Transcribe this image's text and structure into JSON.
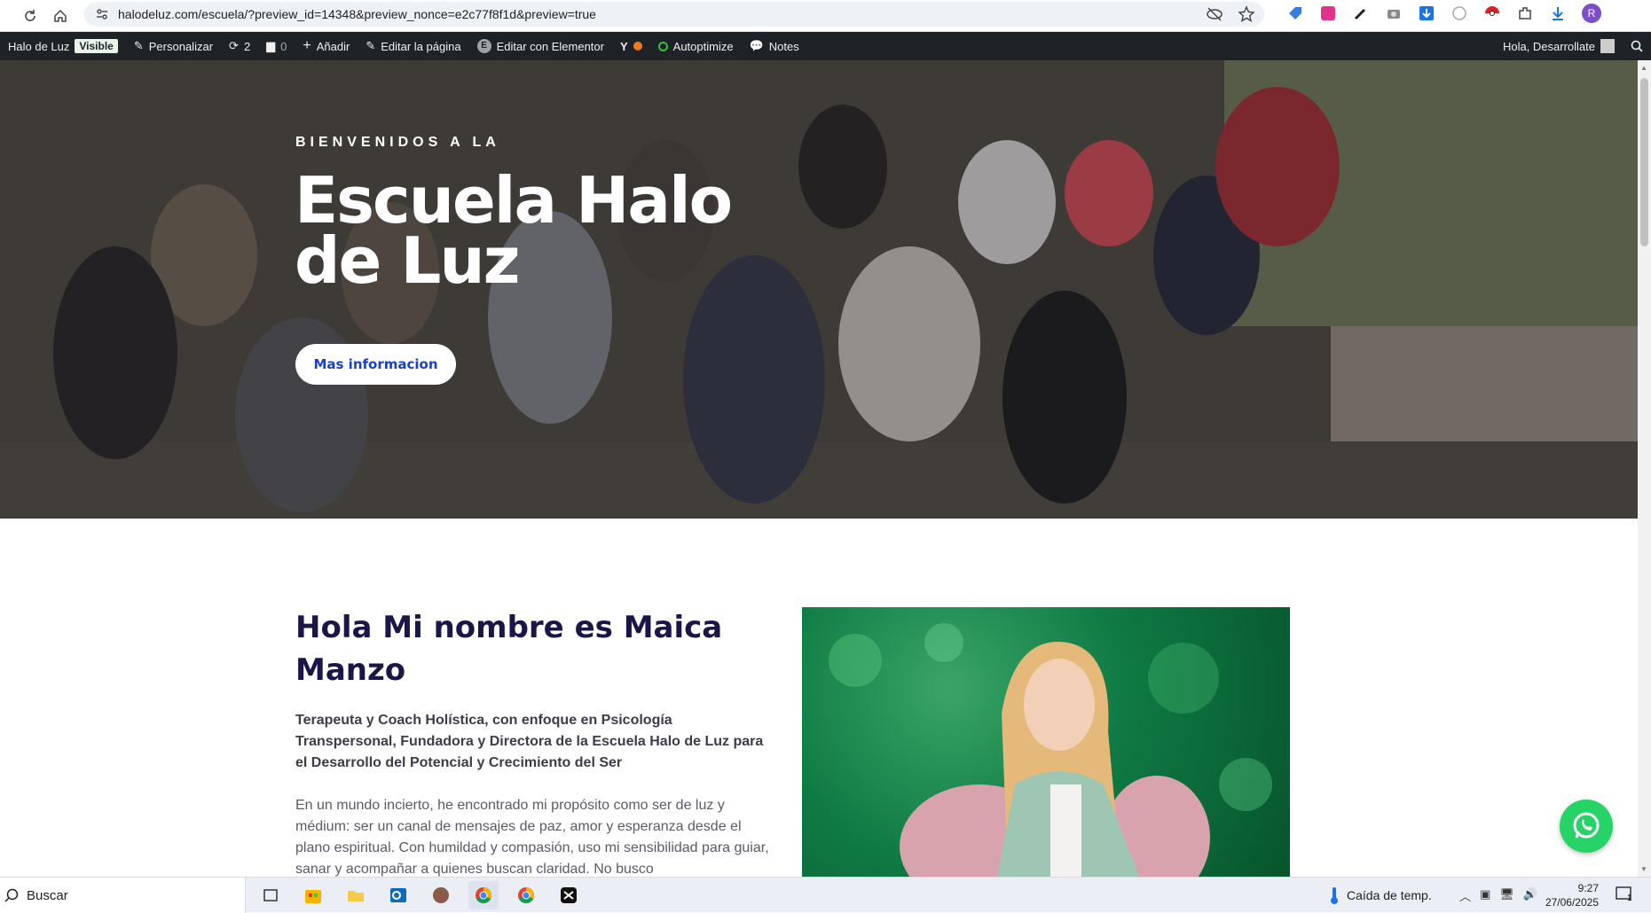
{
  "browser": {
    "url": "halodeluz.com/escuela/?preview_id=14348&preview_nonce=e2c77f8f1d&preview=true",
    "profile_initial": "R"
  },
  "admin_bar": {
    "site_name": "Halo de Luz",
    "visible_badge": "Visible",
    "customize": "Personalizar",
    "updates_count": "2",
    "comments_count": "0",
    "add_new": "Añadir",
    "edit_page": "Editar la página",
    "edit_elementor": "Editar con Elementor",
    "autoptimize": "Autoptimize",
    "notes": "Notes",
    "greeting": "Hola, Desarrollate"
  },
  "hero": {
    "kicker": "BIENVENIDOS A LA",
    "title": "Escuela Halo de Luz",
    "button": "Mas informacion"
  },
  "about": {
    "title": "Hola Mi nombre es Maica Manzo",
    "subtitle": "Terapeuta y Coach Holística, con enfoque en Psicología Transpersonal, Fundadora y Directora de la Escuela Halo de Luz para el Desarrollo del Potencial y Crecimiento del Ser",
    "body": "En un mundo incierto, he encontrado mi propósito como ser de luz y médium: ser un canal de mensajes de paz, amor y esperanza desde el plano espiritual. Con humildad y compasión, uso mi sensibilidad para guiar, sanar y acompañar a quienes buscan claridad. No busco"
  },
  "taskbar": {
    "search_placeholder": "Buscar",
    "weather": "Caída de temp.",
    "time": "9:27",
    "date": "27/06/2025",
    "notifications": "1"
  },
  "colors": {
    "admin_bar_bg": "#1d2327",
    "heading": "#1b1648",
    "button_text": "#1a3fc7",
    "whatsapp": "#25d366"
  }
}
